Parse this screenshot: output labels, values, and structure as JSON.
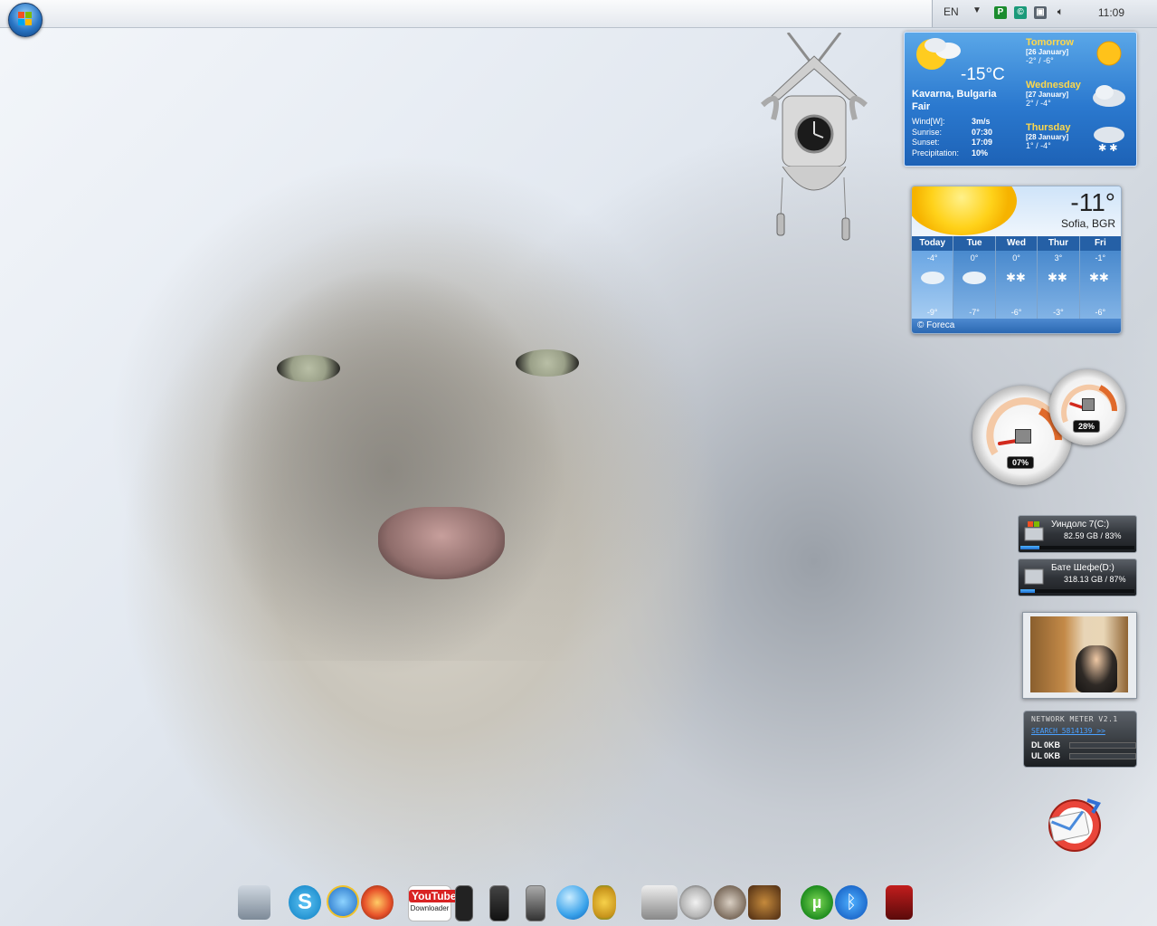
{
  "taskbar": {
    "language": "EN",
    "clock": "11:09"
  },
  "weather_main": {
    "current_temp": "-15°C",
    "location": "Kavarna, Bulgaria",
    "condition": "Fair",
    "details": [
      {
        "label": "Wind[W]:",
        "value": "3m/s"
      },
      {
        "label": "Sunrise:",
        "value": "07:30"
      },
      {
        "label": "Sunset:",
        "value": "17:09"
      },
      {
        "label": "Precipitation:",
        "value": "10%"
      }
    ],
    "forecast": [
      {
        "day": "Tomorrow",
        "date": "[26 January]",
        "range": "-2°  /  -6°",
        "icon": "sun-icon"
      },
      {
        "day": "Wednesday",
        "date": "[27 January]",
        "range": "2°   /  -4°",
        "icon": "cloud-icon"
      },
      {
        "day": "Thursday",
        "date": "[28 January]",
        "range": "1°   /  -4°",
        "icon": "snow-icon"
      }
    ]
  },
  "weather_small": {
    "temp": "-11°",
    "city": "Sofia, BGR",
    "days": [
      {
        "day": "Today",
        "hi": "-4°",
        "lo": "-9°"
      },
      {
        "day": "Tue",
        "hi": "0°",
        "lo": "-7°"
      },
      {
        "day": "Wed",
        "hi": "0°",
        "lo": "-6°"
      },
      {
        "day": "Thur",
        "hi": "3°",
        "lo": "-3°"
      },
      {
        "day": "Fri",
        "hi": "-1°",
        "lo": "-6°"
      }
    ],
    "provider": "© Foreca"
  },
  "meters": {
    "cpu_label": "07%",
    "ram_label": "28%",
    "cpu_value": 0.07,
    "ram_value": 0.28
  },
  "drives": [
    {
      "name": "Уиндолс 7(C:)",
      "size": "82.59 GB / 83%",
      "used": 0.17
    },
    {
      "name": "Бате Шефе(D:)",
      "size": "318.13 GB / 87%",
      "used": 0.13
    }
  ],
  "network_meter": {
    "title": "NETWORK METER V2.1",
    "link": "SEARCH 5814139 >>",
    "down_label": "DL",
    "down_value": "0KB",
    "up_label": "UL",
    "up_value": "0KB"
  },
  "dock": {
    "items": [
      "computer-icon",
      "skype-icon",
      "internet-explorer-icon",
      "firefox-icon",
      "youtube-downloader-icon",
      "phone-icon",
      "iphone-icon",
      "ipod-icon",
      "apple-icon",
      "pineapple-icon",
      "car-game-icon",
      "mask-icon",
      "skull-icon",
      "game-icon",
      "utorrent-icon",
      "bluetooth-icon",
      "app-icon"
    ],
    "youtube_label": "YouTube",
    "youtube_sublabel": "Downloader"
  },
  "colors": {
    "weather_blue": "#2b79cf",
    "forecast_yellow": "#ffd84a",
    "meter_red": "#d22a1d"
  }
}
